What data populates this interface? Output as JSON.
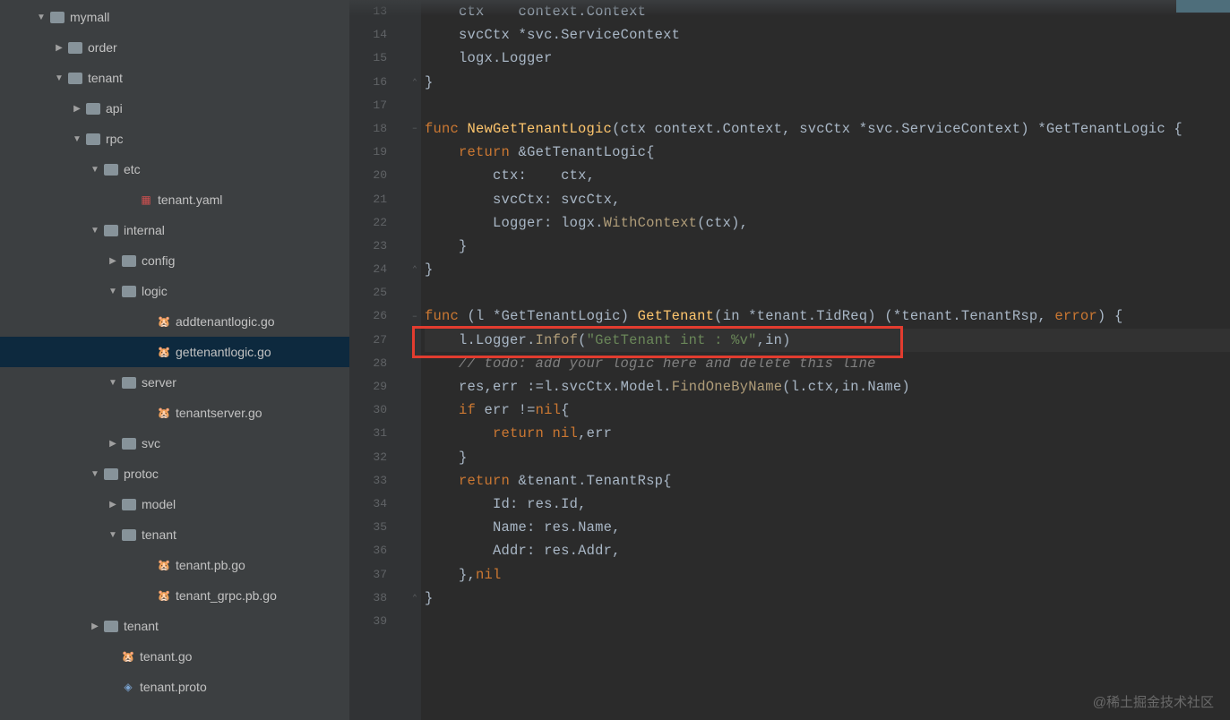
{
  "watermark": "@稀土掘金技术社区",
  "tree": [
    {
      "indent": 40,
      "arrow": "down",
      "kind": "folder",
      "name": "mymall",
      "interactable": true
    },
    {
      "indent": 60,
      "arrow": "right",
      "kind": "folder",
      "name": "order",
      "interactable": true
    },
    {
      "indent": 60,
      "arrow": "down",
      "kind": "folder",
      "name": "tenant",
      "interactable": true
    },
    {
      "indent": 80,
      "arrow": "right",
      "kind": "folder",
      "name": "api",
      "interactable": true
    },
    {
      "indent": 80,
      "arrow": "down",
      "kind": "folder",
      "name": "rpc",
      "interactable": true
    },
    {
      "indent": 100,
      "arrow": "down",
      "kind": "folder",
      "name": "etc",
      "interactable": true
    },
    {
      "indent": 140,
      "arrow": "none",
      "kind": "yaml",
      "name": "tenant.yaml",
      "interactable": true
    },
    {
      "indent": 100,
      "arrow": "down",
      "kind": "folder",
      "name": "internal",
      "interactable": true
    },
    {
      "indent": 120,
      "arrow": "right",
      "kind": "folder",
      "name": "config",
      "interactable": true
    },
    {
      "indent": 120,
      "arrow": "down",
      "kind": "folder",
      "name": "logic",
      "interactable": true
    },
    {
      "indent": 160,
      "arrow": "none",
      "kind": "go",
      "name": "addtenantlogic.go",
      "interactable": true
    },
    {
      "indent": 160,
      "arrow": "none",
      "kind": "go",
      "name": "gettenantlogic.go",
      "interactable": true,
      "selected": true
    },
    {
      "indent": 120,
      "arrow": "down",
      "kind": "folder",
      "name": "server",
      "interactable": true
    },
    {
      "indent": 160,
      "arrow": "none",
      "kind": "go",
      "name": "tenantserver.go",
      "interactable": true
    },
    {
      "indent": 120,
      "arrow": "right",
      "kind": "folder",
      "name": "svc",
      "interactable": true
    },
    {
      "indent": 100,
      "arrow": "down",
      "kind": "folder",
      "name": "protoc",
      "interactable": true
    },
    {
      "indent": 120,
      "arrow": "right",
      "kind": "folder",
      "name": "model",
      "interactable": true
    },
    {
      "indent": 120,
      "arrow": "down",
      "kind": "folder",
      "name": "tenant",
      "interactable": true
    },
    {
      "indent": 160,
      "arrow": "none",
      "kind": "go",
      "name": "tenant.pb.go",
      "interactable": true
    },
    {
      "indent": 160,
      "arrow": "none",
      "kind": "go",
      "name": "tenant_grpc.pb.go",
      "interactable": true
    },
    {
      "indent": 100,
      "arrow": "right",
      "kind": "folder",
      "name": "tenant",
      "interactable": true
    },
    {
      "indent": 120,
      "arrow": "none",
      "kind": "go",
      "name": "tenant.go",
      "interactable": true
    },
    {
      "indent": 120,
      "arrow": "none",
      "kind": "proto",
      "name": "tenant.proto",
      "interactable": true
    }
  ],
  "lines": [
    {
      "n": 13,
      "fold": "",
      "html": "    <span class='c-id'>ctx</span>    <span class='c-id'>context</span><span class='c-dot'>.</span><span class='c-id'>Context</span>"
    },
    {
      "n": 14,
      "fold": "",
      "html": "    <span class='c-id'>svcCtx</span> <span class='c-op'>*</span><span class='c-id'>svc</span><span class='c-dot'>.</span><span class='c-id'>ServiceContext</span>"
    },
    {
      "n": 15,
      "fold": "",
      "html": "    <span class='c-id'>logx</span><span class='c-dot'>.</span><span class='c-id'>Logger</span>"
    },
    {
      "n": 16,
      "fold": "⌃",
      "html": "<span class='c-op'>}</span>"
    },
    {
      "n": 17,
      "fold": "",
      "html": ""
    },
    {
      "n": 18,
      "fold": "−",
      "html": "<span class='c-kw'>func</span> <span class='c-fn'>NewGetTenantLogic</span><span class='c-op'>(</span><span class='c-id'>ctx</span> <span class='c-id'>context</span><span class='c-dot'>.</span><span class='c-id'>Context</span><span class='c-op'>,</span> <span class='c-id'>svcCtx</span> <span class='c-op'>*</span><span class='c-id'>svc</span><span class='c-dot'>.</span><span class='c-id'>ServiceContext</span><span class='c-op'>)</span> <span class='c-op'>*</span><span class='c-id'>GetTenantLogic</span> <span class='c-op'>{</span>"
    },
    {
      "n": 19,
      "fold": "",
      "html": "    <span class='c-kw'>return</span> <span class='c-op'>&amp;</span><span class='c-id'>GetTenantLogic</span><span class='c-op'>{</span>"
    },
    {
      "n": 20,
      "fold": "",
      "html": "        <span class='c-id'>ctx</span><span class='c-op'>:</span>    <span class='c-id'>ctx</span><span class='c-op'>,</span>"
    },
    {
      "n": 21,
      "fold": "",
      "html": "        <span class='c-id'>svcCtx</span><span class='c-op'>:</span> <span class='c-id'>svcCtx</span><span class='c-op'>,</span>"
    },
    {
      "n": 22,
      "fold": "",
      "html": "        <span class='c-id'>Logger</span><span class='c-op'>:</span> <span class='c-id'>logx</span><span class='c-dot'>.</span><span class='c-call'>WithContext</span><span class='c-op'>(</span><span class='c-id'>ctx</span><span class='c-op'>),</span>"
    },
    {
      "n": 23,
      "fold": "",
      "html": "    <span class='c-op'>}</span>"
    },
    {
      "n": 24,
      "fold": "⌃",
      "html": "<span class='c-op'>}</span>"
    },
    {
      "n": 25,
      "fold": "",
      "html": ""
    },
    {
      "n": 26,
      "fold": "−",
      "html": "<span class='c-kw'>func</span> <span class='c-op'>(</span><span class='c-id'>l</span> <span class='c-op'>*</span><span class='c-id'>GetTenantLogic</span><span class='c-op'>)</span> <span class='c-fn'>GetTenant</span><span class='c-op'>(</span><span class='c-id'>in</span> <span class='c-op'>*</span><span class='c-id'>tenant</span><span class='c-dot'>.</span><span class='c-id'>TidReq</span><span class='c-op'>)</span> <span class='c-op'>(*</span><span class='c-id'>tenant</span><span class='c-dot'>.</span><span class='c-id'>TenantRsp</span><span class='c-op'>,</span> <span class='c-kw'>error</span><span class='c-op'>)</span> <span class='c-op'>{</span>"
    },
    {
      "n": 27,
      "fold": "",
      "current": true,
      "html": "    <span class='c-id'>l</span><span class='c-dot'>.</span><span class='c-id'>Logger</span><span class='c-dot'>.</span><span class='c-call'>Infof</span><span class='c-op'>(</span><span class='c-st'>&quot;GetTenant int : %v&quot;</span><span class='c-op'>,</span><span class='c-id'>in</span><span class='c-op'>)</span>"
    },
    {
      "n": 28,
      "fold": "",
      "html": "    <span class='c-cm'>// todo: add your logic here and delete this line</span>"
    },
    {
      "n": 29,
      "fold": "",
      "html": "    <span class='c-id'>res</span><span class='c-op'>,</span><span class='c-id'>err</span> <span class='c-op'>:=</span><span class='c-id'>l</span><span class='c-dot'>.</span><span class='c-id'>svcCtx</span><span class='c-dot'>.</span><span class='c-id'>Model</span><span class='c-dot'>.</span><span class='c-call'>FindOneByName</span><span class='c-op'>(</span><span class='c-id'>l</span><span class='c-dot'>.</span><span class='c-id'>ctx</span><span class='c-op'>,</span><span class='c-id'>in</span><span class='c-dot'>.</span><span class='c-id'>Name</span><span class='c-op'>)</span>"
    },
    {
      "n": 30,
      "fold": "",
      "html": "    <span class='c-kw'>if</span> <span class='c-id'>err</span> <span class='c-op'>!=</span><span class='c-kw'>nil</span><span class='c-op'>{</span>"
    },
    {
      "n": 31,
      "fold": "",
      "html": "        <span class='c-kw'>return</span> <span class='c-kw'>nil</span><span class='c-op'>,</span><span class='c-id'>err</span>"
    },
    {
      "n": 32,
      "fold": "",
      "html": "    <span class='c-op'>}</span>"
    },
    {
      "n": 33,
      "fold": "",
      "html": "    <span class='c-kw'>return</span> <span class='c-op'>&amp;</span><span class='c-id'>tenant</span><span class='c-dot'>.</span><span class='c-id'>TenantRsp</span><span class='c-op'>{</span>"
    },
    {
      "n": 34,
      "fold": "",
      "html": "        <span class='c-id'>Id</span><span class='c-op'>:</span> <span class='c-id'>res</span><span class='c-dot'>.</span><span class='c-id'>Id</span><span class='c-op'>,</span>"
    },
    {
      "n": 35,
      "fold": "",
      "html": "        <span class='c-id'>Name</span><span class='c-op'>:</span> <span class='c-id'>res</span><span class='c-dot'>.</span><span class='c-id'>Name</span><span class='c-op'>,</span>"
    },
    {
      "n": 36,
      "fold": "",
      "html": "        <span class='c-id'>Addr</span><span class='c-op'>:</span> <span class='c-id'>res</span><span class='c-dot'>.</span><span class='c-id'>Addr</span><span class='c-op'>,</span>"
    },
    {
      "n": 37,
      "fold": "",
      "html": "    <span class='c-op'>},</span><span class='c-kw'>nil</span>"
    },
    {
      "n": 38,
      "fold": "⌃",
      "html": "<span class='c-op'>}</span>"
    },
    {
      "n": 39,
      "fold": "",
      "html": ""
    }
  ]
}
